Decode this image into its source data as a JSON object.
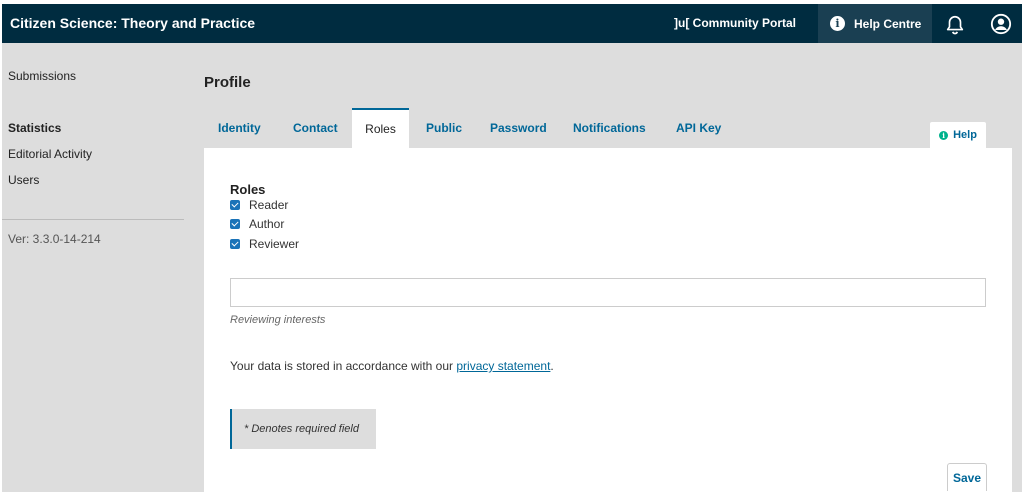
{
  "header": {
    "site_title": "Citizen Science: Theory and Practice",
    "portal_label": "]u[ Community Portal",
    "help_centre_label": "Help Centre",
    "info_glyph": "i"
  },
  "sidebar": {
    "items": [
      {
        "label": "Submissions"
      },
      {
        "label": "Statistics"
      },
      {
        "label": "Editorial Activity"
      },
      {
        "label": "Users"
      }
    ],
    "version": "Ver: 3.3.0-14-214"
  },
  "main": {
    "page_title": "Profile",
    "tabs": [
      {
        "label": "Identity"
      },
      {
        "label": "Contact"
      },
      {
        "label": "Roles"
      },
      {
        "label": "Public"
      },
      {
        "label": "Password"
      },
      {
        "label": "Notifications"
      },
      {
        "label": "API Key"
      }
    ],
    "active_tab": "Roles",
    "help_label": "Help",
    "help_glyph": "i",
    "roles_title": "Roles",
    "roles": [
      {
        "label": "Reader",
        "checked": true
      },
      {
        "label": "Author",
        "checked": true
      },
      {
        "label": "Reviewer",
        "checked": true
      }
    ],
    "reviewing_interests": {
      "value": "",
      "description": "Reviewing interests"
    },
    "privacy_text": "Your data is stored in accordance with our ",
    "privacy_link": "privacy statement",
    "privacy_end": ".",
    "required_note": "* Denotes required field",
    "save_label": "Save"
  },
  "colors": {
    "header_bg": "#002c40",
    "accent": "#006798",
    "checkbox": "#1a73b8",
    "help_dot": "#00b28d"
  },
  "icons": [
    "info-icon",
    "bell-icon",
    "user-account-icon",
    "checkbox-checked-icon"
  ]
}
